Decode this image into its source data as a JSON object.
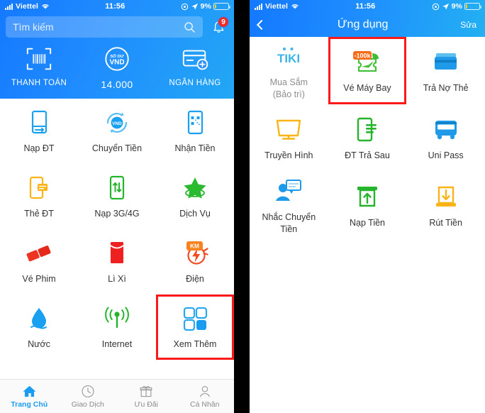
{
  "status_bar": {
    "carrier": "Viettel",
    "time": "11:56",
    "battery_percent": "9%",
    "signal_icon": "signal-bars-icon",
    "wifi_icon": "wifi-icon",
    "alarm_icon": "alarm-icon",
    "location_icon": "location-arrow-icon",
    "battery_icon": "battery-icon"
  },
  "left_screen": {
    "search": {
      "placeholder": "Tìm kiếm",
      "icon": "search-icon"
    },
    "notification": {
      "icon": "bell-icon",
      "badge": "9"
    },
    "quick_actions": [
      {
        "label": "THANH TOÁN",
        "icon": "barcode-scan-icon"
      },
      {
        "label": "14.000",
        "icon": "balance-vnd-icon",
        "icon_top": "SỐ DƯ",
        "icon_bottom": "VND"
      },
      {
        "label": "NGÂN HÀNG",
        "icon": "add-bank-card-icon"
      }
    ],
    "services": [
      {
        "label": "Nạp ĐT",
        "icon": "topup-phone-icon",
        "color": "#1aa0f0",
        "highlighted": false
      },
      {
        "label": "Chuyển Tiền",
        "icon": "transfer-money-icon",
        "color": "#1aa0f0",
        "highlighted": false
      },
      {
        "label": "Nhận Tiền",
        "icon": "receive-money-qr-icon",
        "color": "#1aa0f0",
        "highlighted": false
      },
      {
        "label": "Thẻ ĐT",
        "icon": "phone-card-icon",
        "color": "#fbb417",
        "highlighted": false
      },
      {
        "label": "Nạp 3G/4G",
        "icon": "data-topup-icon",
        "color": "#25b42b",
        "highlighted": false
      },
      {
        "label": "Dịch Vụ",
        "icon": "services-star-icon",
        "color": "#25b42b",
        "highlighted": false
      },
      {
        "label": "Vé Phim",
        "icon": "movie-ticket-icon",
        "color": "#ee3322",
        "highlighted": false
      },
      {
        "label": "Lì Xì",
        "icon": "lucky-money-envelope-icon",
        "color": "#ee2020",
        "highlighted": false
      },
      {
        "label": "Điện",
        "icon": "electricity-icon",
        "color": "#f04b23",
        "badge": "KM",
        "highlighted": false
      },
      {
        "label": "Nước",
        "icon": "water-drop-icon",
        "color": "#1aa0f0",
        "highlighted": false
      },
      {
        "label": "Internet",
        "icon": "internet-signal-icon",
        "color": "#25b42b",
        "highlighted": false
      },
      {
        "label": "Xem Thêm",
        "icon": "more-grid-icon",
        "color": "#1a9cf0",
        "highlighted": true
      }
    ],
    "tabs": [
      {
        "label": "Trang Chủ",
        "icon": "home-icon",
        "active": true
      },
      {
        "label": "Giao Dịch",
        "icon": "clock-history-icon",
        "active": false
      },
      {
        "label": "Ưu Đãi",
        "icon": "gift-icon",
        "active": false
      },
      {
        "label": "Cá Nhân",
        "icon": "user-profile-icon",
        "active": false
      }
    ]
  },
  "right_screen": {
    "nav": {
      "back_icon": "back-chevron-icon",
      "title": "Ứng dụng",
      "edit_label": "Sửa"
    },
    "apps": [
      {
        "label": "Mua Sắm\n(Bảo trì)",
        "label_line1": "Mua Sắm",
        "label_line2": "(Bảo trì)",
        "icon": "tiki-logo-icon",
        "logo_text": "TIKI",
        "dimmed": true,
        "highlighted": false
      },
      {
        "label": "Vé Máy Bay",
        "icon": "flight-ticket-icon",
        "badge": "-100k",
        "color": "#44c13a",
        "highlighted": true
      },
      {
        "label": "Trả Nợ Thẻ",
        "icon": "credit-card-repay-icon",
        "color": "#1e9ae8",
        "highlighted": false
      },
      {
        "label": "Truyền Hình",
        "icon": "tv-icon",
        "color": "#fbb417",
        "highlighted": false
      },
      {
        "label": "ĐT Trả Sau",
        "icon": "postpaid-phone-icon",
        "color": "#25b42b",
        "highlighted": false
      },
      {
        "label": "Uni Pass",
        "icon": "bus-icon",
        "color": "#1e9ae8",
        "highlighted": false
      },
      {
        "label": "Nhắc Chuyển\nTiền",
        "label_line1": "Nhắc Chuyển",
        "label_line2": "Tiền",
        "icon": "remind-transfer-icon",
        "color": "#1e9ae8",
        "highlighted": false
      },
      {
        "label": "Nạp Tiền",
        "icon": "deposit-up-icon",
        "color": "#25b42b",
        "highlighted": false
      },
      {
        "label": "Rút Tiền",
        "icon": "withdraw-down-icon",
        "color": "#fbb417",
        "highlighted": false
      }
    ]
  },
  "colors": {
    "brand_blue": "#1a9cf0",
    "highlight_red": "#fb1a1a",
    "orange": "#f96a17",
    "green": "#25b42b",
    "yellow": "#fbb417"
  }
}
